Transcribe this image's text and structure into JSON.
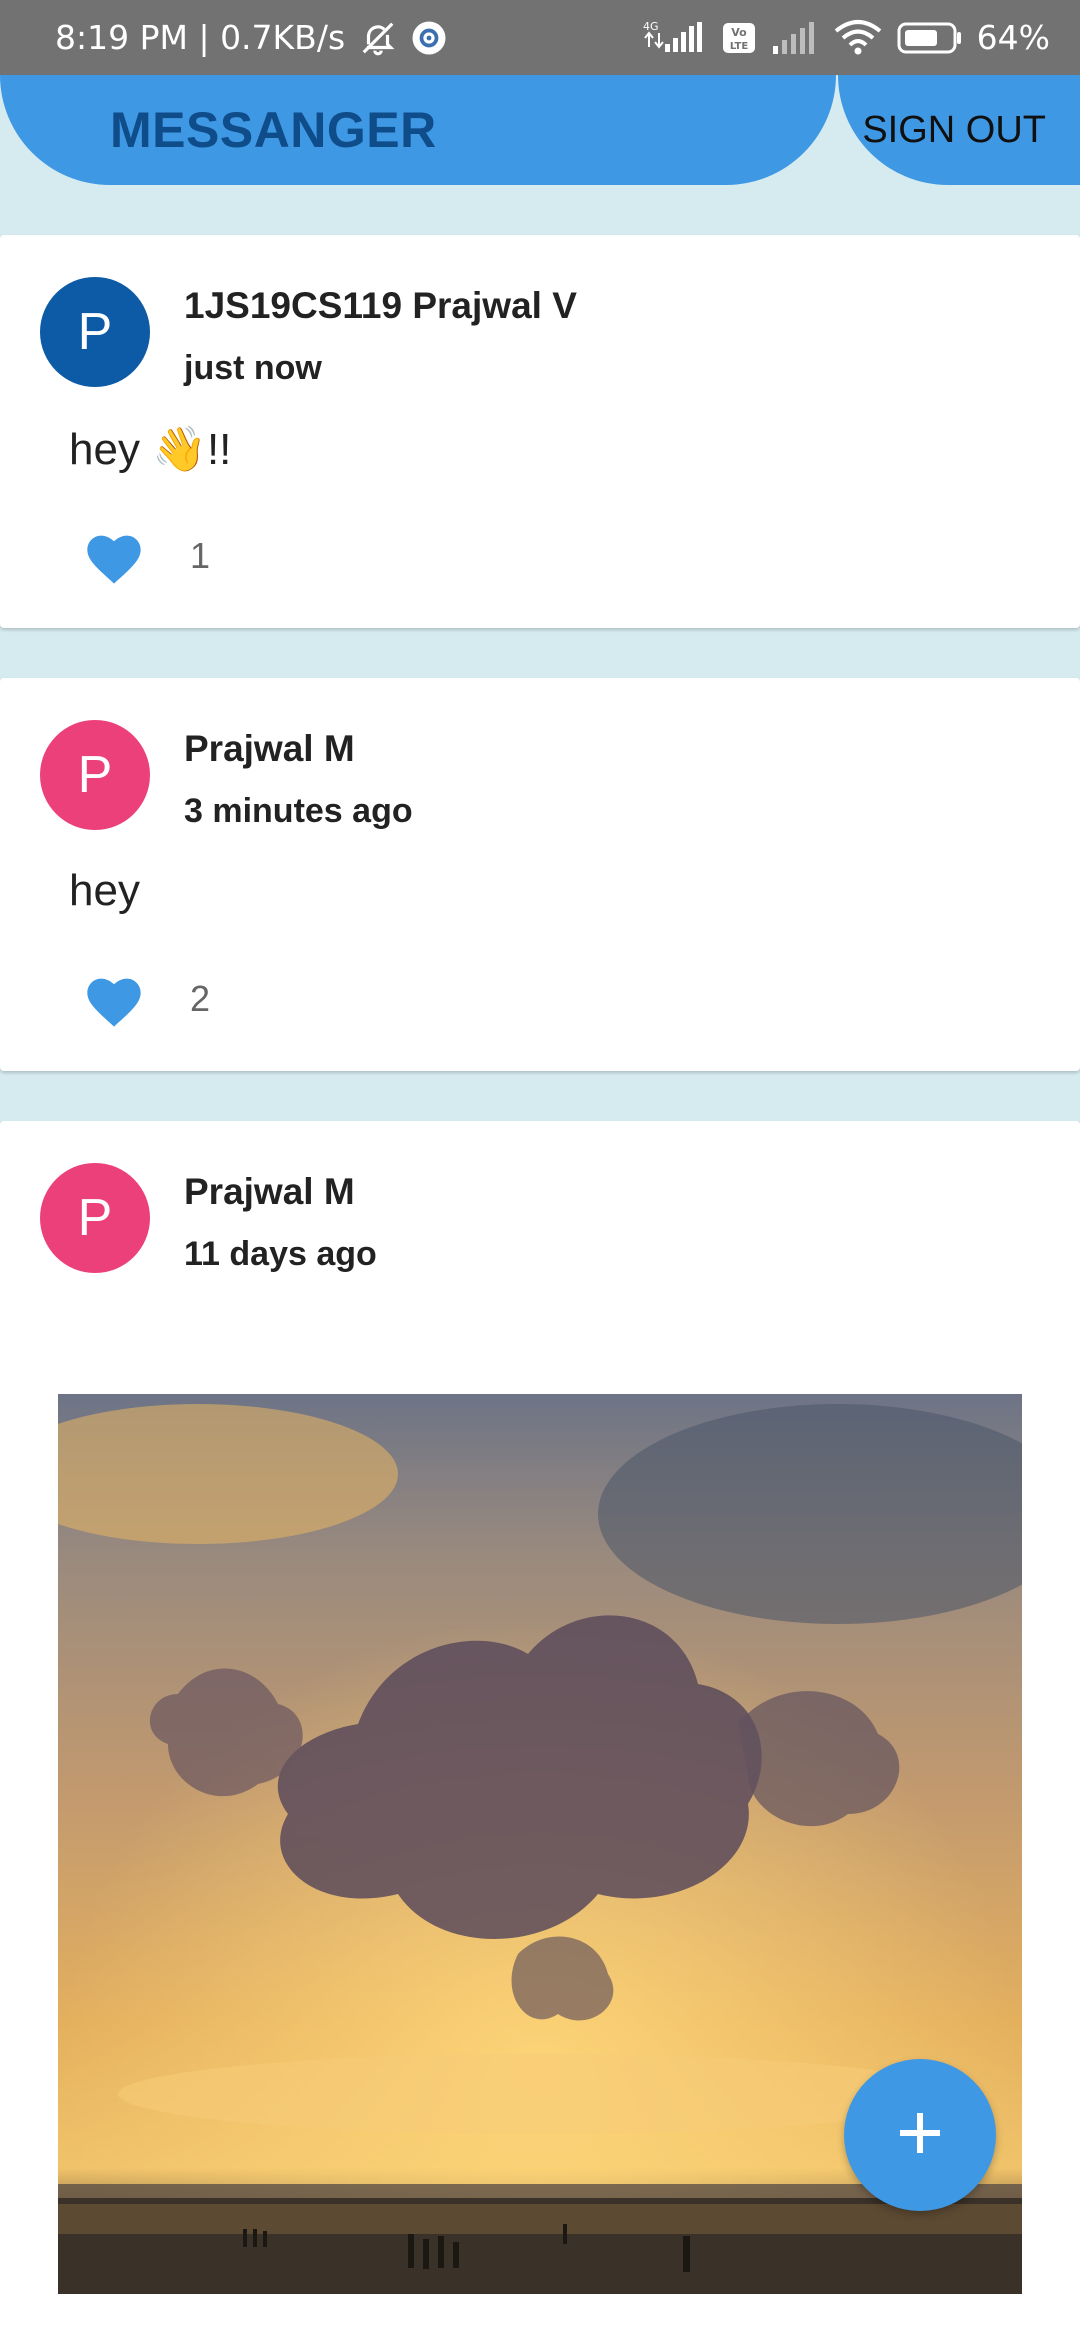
{
  "status_bar": {
    "time": "8:19 PM | 0.7KB/s",
    "network_label": "4G",
    "volte_label": "Vo LTE",
    "battery": "64%"
  },
  "app_bar": {
    "title": "MESSANGER",
    "sign_out_label": "SIGN OUT",
    "color": "#3f98e4"
  },
  "posts": [
    {
      "avatar_letter": "P",
      "avatar_color": "#0d5aa7",
      "author": "1JS19CS119 Prajwal V",
      "time": "just now",
      "message": "hey 👋!!",
      "likes": "1"
    },
    {
      "avatar_letter": "P",
      "avatar_color": "#ec407a",
      "author": "Prajwal M",
      "time": "3 minutes ago",
      "message": "hey",
      "likes": "2"
    },
    {
      "avatar_letter": "P",
      "avatar_color": "#ec407a",
      "author": "Prajwal M",
      "time": "11 days ago",
      "image": "sunset-clouds-beach-photo"
    }
  ],
  "fab": {
    "icon": "plus-icon"
  }
}
